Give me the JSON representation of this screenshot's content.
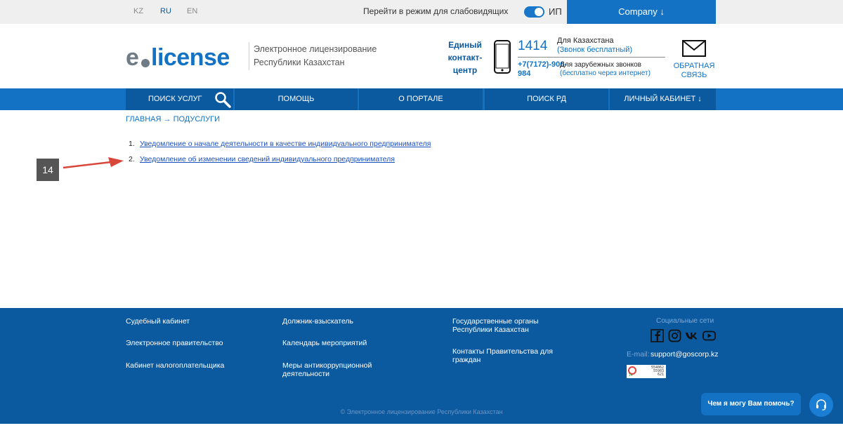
{
  "topbar": {
    "languages": [
      "KZ",
      "RU",
      "EN"
    ],
    "active_language": "RU",
    "visually_impaired_label": "Перейти в режим для слабовидящих",
    "toggle_label": "ИП",
    "company_button": "Company ↓"
  },
  "header": {
    "logo_prefix": "e",
    "logo_name": "license",
    "portal_title": "Электронное лицензирование Республики Казахстан",
    "contact_center": "Единый контакт-центр",
    "short_number": "1414",
    "kz_label": "Для Казахстана",
    "kz_free": "(Звонок бесплатный)",
    "intl_number": "+7(7172)-906-984",
    "intl_label": "Для зарубежных звонков",
    "intl_free": "(бесплатно через интернет)",
    "feedback": "ОБРАТНАЯ СВЯЗЬ"
  },
  "nav": {
    "search": "ПОИСК УСЛУГ",
    "help": "ПОМОЩЬ",
    "about": "О ПОРТАЛЕ",
    "rd": "ПОИСК РД",
    "cabinet": "ЛИЧНЫЙ КАБИНЕТ ↓"
  },
  "breadcrumb": "ГЛАВНАЯ → ПОДУСЛУГИ",
  "items": [
    {
      "num": "1.",
      "label": "Уведомление о начале деятельности в качестве индивидуального предпринимателя"
    },
    {
      "num": "2.",
      "label": "Уведомление об изменении сведений индивидуального предпринимателя"
    }
  ],
  "annotation": {
    "marker": "14",
    "color": "#d9463a"
  },
  "footer": {
    "col1": [
      "Судебный кабинет",
      "Электронное правительство",
      "Кабинет налогоплательщика"
    ],
    "col2": [
      "Должник-взыскатель",
      "Календарь мероприятий",
      "Меры антикоррупционной деятельности"
    ],
    "col3": [
      "Государственные органы Республики Казахстан",
      "Контакты Правительства для граждан"
    ],
    "social_title": "Социальные сети",
    "social_icons": [
      "facebook-icon",
      "instagram-icon",
      "vk-icon",
      "youtube-icon"
    ],
    "email_label": "E-mail:",
    "email": "support@goscorp.kz",
    "counter": [
      "554062",
      "55903",
      "621"
    ],
    "counter_small": "14",
    "copyright": "© Электронное лицензирование Республики Казахстан"
  },
  "chat": {
    "label": "Чем я могу Вам помочь?"
  },
  "colors": {
    "primary": "#1372c4",
    "dark": "#0b5aa0",
    "link": "#1a4fbf"
  }
}
